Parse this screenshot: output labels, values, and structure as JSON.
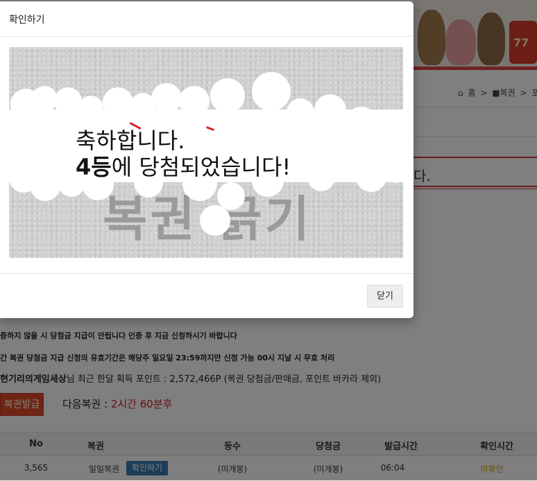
{
  "page": {
    "breadcrumb": [
      "홈",
      ">",
      "■복권",
      ">",
      "포인"
    ],
    "partial_message": "다.",
    "notices": [
      "증하지 않을 시 당첨금 지급이 안됩니다 인증 후 지금 신청하시기 바랍니다",
      "간 복권 당첨금 지급 신청의 유효기간은 해당주 일요일 23:59까지만 신청 가능 00시 지날 시 무효 처리"
    ],
    "points": {
      "username": "현기리의게임세상",
      "suffix": "님 최근 한달 획득 포인트 : 2,572,466P (복권 당첨금/판매금, 포인트 바카라 제외)"
    },
    "issue_button": "복권발급",
    "next_lottery": {
      "label": "다음복권 :",
      "value": "2시간 60분후"
    },
    "table": {
      "headers": [
        "No",
        "복권",
        "등수",
        "당첨금",
        "발급시간",
        "확인시간"
      ],
      "rows": [
        {
          "no": "3,565",
          "name": "일일복권",
          "button": "확인하기",
          "rank": "(미개봉)",
          "prize": "(미개봉)",
          "issued": "06:04",
          "checked": "미확인"
        }
      ]
    },
    "colors": {
      "accent_red": "#e04a24",
      "button_blue": "#3a78b0",
      "unchecked_yellow": "#c8a000"
    }
  },
  "modal": {
    "title": "확인하기",
    "ghost_text": "복권 긁기",
    "result_line1": "축하합니다.",
    "result_rank": "4등",
    "result_line2_rest": "에 당첨되었습니다!",
    "close_label": "닫기"
  }
}
